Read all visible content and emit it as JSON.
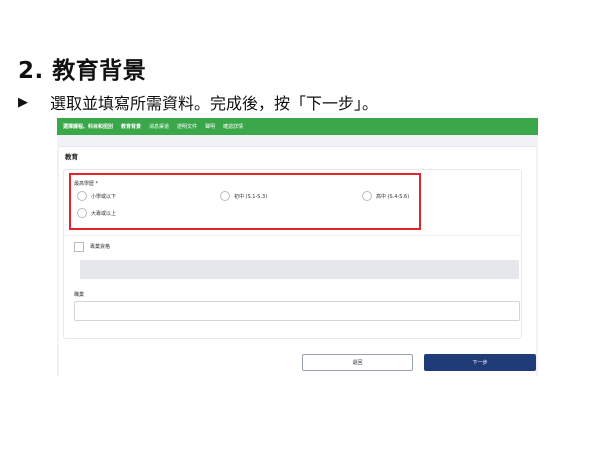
{
  "heading": "2. 教育背景",
  "instruction": {
    "arrow": "▶",
    "text": "選取並填寫所需資料。完成後，按「下一步」。"
  },
  "navbar": {
    "color": "#3aa84a",
    "tabs": [
      "選擇課程、科目和扭別",
      "教育背景",
      "消息渠道",
      "證明文件",
      "聲明",
      "確認詳情"
    ],
    "active_index": 1
  },
  "section": {
    "title": "教育",
    "education_level": {
      "label": "最高學歷 *",
      "options": [
        "小學或以下",
        "初中 (S.1-S.3)",
        "高中 (S.4-S.6)",
        "大專或以上"
      ]
    },
    "professional": {
      "label": "專業資格",
      "checked": false
    },
    "occupation": {
      "label": "職業",
      "value": ""
    }
  },
  "buttons": {
    "back": "退回",
    "next": "下一步"
  }
}
